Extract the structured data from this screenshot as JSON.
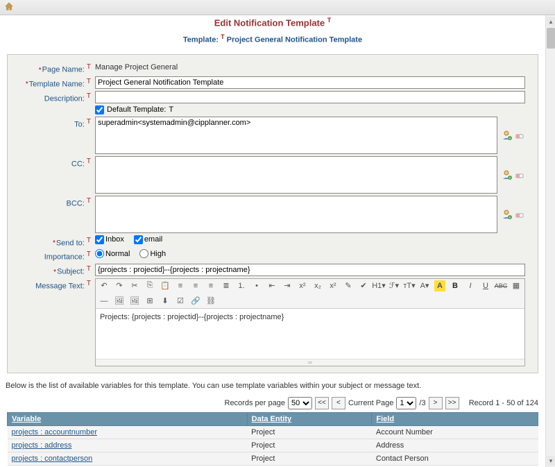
{
  "header": {
    "title": "Edit Notification Template"
  },
  "subtitle": {
    "label": "Template:",
    "value": "Project General Notification Template"
  },
  "form": {
    "page_name_label": "Page Name:",
    "page_name_value": "Manage Project General",
    "template_name_label": "Template Name:",
    "template_name_value": "Project General Notification Template",
    "description_label": "Description:",
    "description_value": "",
    "default_template_label": "Default Template:",
    "default_template_checked": true,
    "to_label": "To:",
    "to_value": "superadmin<systemadmin@cipplanner.com>",
    "cc_label": "CC:",
    "cc_value": "",
    "bcc_label": "BCC:",
    "bcc_value": "",
    "send_to_label": "Send to:",
    "send_to_inbox_label": "Inbox",
    "send_to_inbox_checked": true,
    "send_to_email_label": "email",
    "send_to_email_checked": true,
    "importance_label": "Importance:",
    "importance_normal_label": "Normal",
    "importance_high_label": "High",
    "importance_value": "Normal",
    "subject_label": "Subject:",
    "subject_value": "{projects : projectid}--{projects : projectname}",
    "message_text_label": "Message Text:",
    "message_text_value": "Projects: {projects : projectid}--{projects : projectname}"
  },
  "info_text": "Below is the list of available variables for this template. You can use template variables within your subject or message text.",
  "pagination": {
    "rpp_label": "Records per page",
    "rpp_value": "50",
    "first": "<<",
    "prev": "<",
    "current_label": "Current Page",
    "current_value": "1",
    "total_pages": "/3",
    "next": ">",
    "last": ">>",
    "record_range": "Record 1 - 50 of 124"
  },
  "table": {
    "col_variable": "Variable",
    "col_entity": "Data Entity",
    "col_field": "Field",
    "rows": [
      {
        "variable": "projects : accountnumber",
        "entity": "Project",
        "field": "Account Number"
      },
      {
        "variable": "projects : address",
        "entity": "Project",
        "field": "Address"
      },
      {
        "variable": "projects : contactperson",
        "entity": "Project",
        "field": "Contact Person"
      }
    ]
  },
  "toolbar_icons": [
    "undo",
    "redo",
    "cut",
    "copy",
    "paste",
    "align-left",
    "align-center",
    "align-right",
    "align-justify",
    "list-ol",
    "list-ul",
    "outdent",
    "indent",
    "superscript",
    "subscript",
    "sup2",
    "clear-fmt",
    "spellcheck",
    "heading",
    "font",
    "font-size",
    "font-color",
    "highlight",
    "bold",
    "italic",
    "underline",
    "abc",
    "grid",
    "hr",
    "img1",
    "img2",
    "table",
    "insert",
    "checkbox",
    "link",
    "unlink"
  ]
}
